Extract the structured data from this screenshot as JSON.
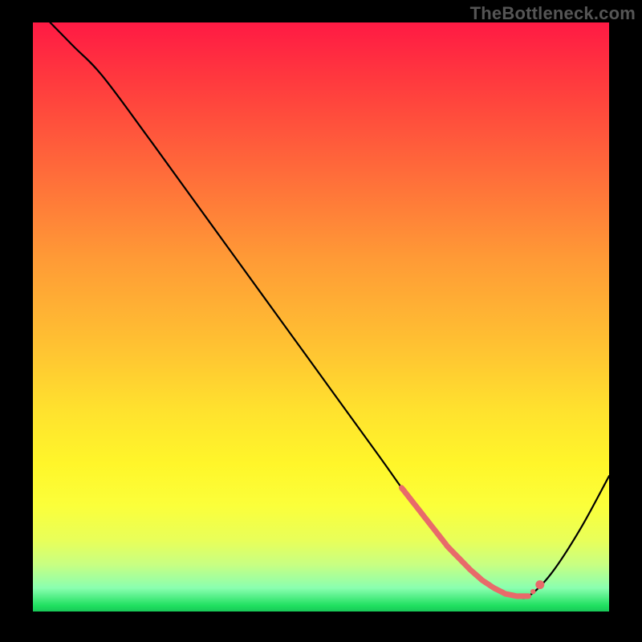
{
  "watermark": "TheBottleneck.com",
  "colors": {
    "background": "#000000",
    "curve": "#000000",
    "highlight": "#e86a6a",
    "gradient_top": "#ff1a44",
    "gradient_bottom": "#18c858"
  },
  "chart_data": {
    "type": "line",
    "title": "",
    "xlabel": "",
    "ylabel": "",
    "xlim": [
      0,
      100
    ],
    "ylim": [
      0,
      100
    ],
    "x": [
      3,
      7,
      12,
      20,
      30,
      40,
      50,
      60,
      64,
      66,
      68,
      70,
      72,
      74,
      76,
      78,
      80,
      82,
      84,
      86,
      90,
      95,
      100
    ],
    "y": [
      100,
      96,
      91,
      80.5,
      67,
      53.5,
      40,
      26.5,
      21,
      18.5,
      16,
      13.5,
      11,
      9,
      7,
      5.3,
      4,
      3,
      2.6,
      2.6,
      6.5,
      14,
      23
    ],
    "highlight_range_x": [
      64,
      86
    ],
    "highlight_marker_x": 88,
    "annotations": []
  }
}
